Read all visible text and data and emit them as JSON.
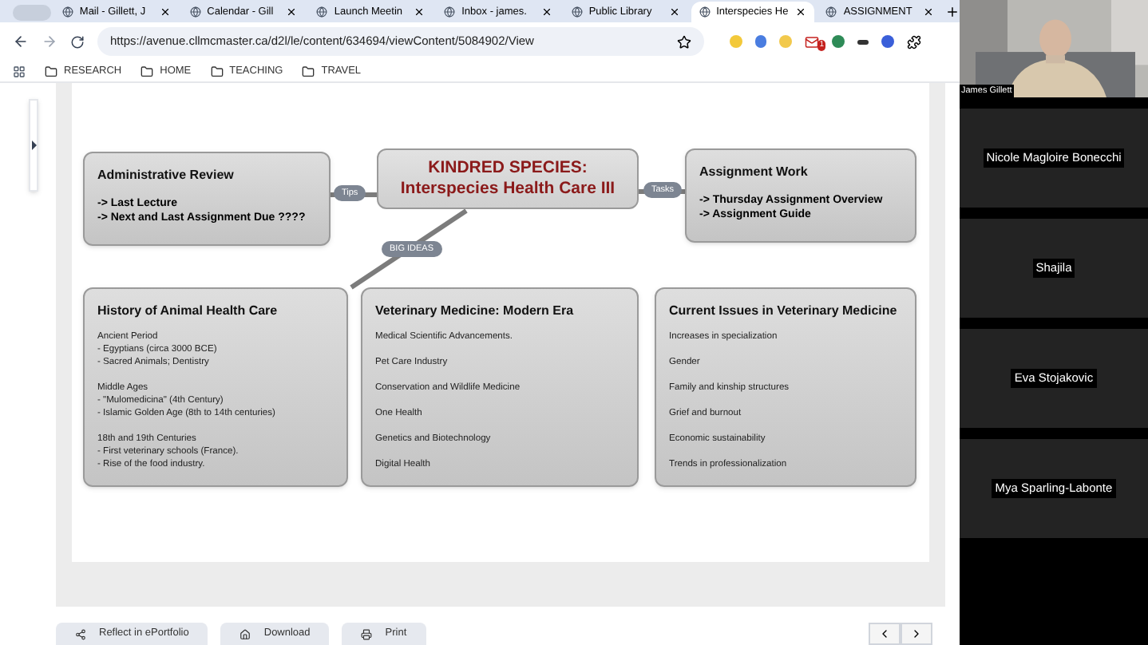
{
  "tabs": [
    {
      "label": "Mail - Gillett, J",
      "selected": false
    },
    {
      "label": "Calendar - Gill",
      "selected": false
    },
    {
      "label": "Launch Meetin",
      "selected": false
    },
    {
      "label": "Inbox - james.",
      "selected": false
    },
    {
      "label": "Public Library",
      "selected": false
    },
    {
      "label": "Interspecies He",
      "selected": true
    },
    {
      "label": "ASSIGNMENT",
      "selected": false
    }
  ],
  "url": "https://avenue.cllmcmaster.ca/d2l/le/content/634694/viewContent/5084902/View",
  "extension_badge": "1",
  "bookmarks": [
    "RESEARCH",
    "HOME",
    "TEACHING",
    "TRAVEL"
  ],
  "mindmap": {
    "center": [
      "KINDRED SPECIES:",
      "Interspecies Health Care III"
    ],
    "connectors": [
      "Tips",
      "Tasks",
      "BIG IDEAS"
    ],
    "top_nodes": [
      {
        "title": "Administrative Review",
        "lines": [
          "-> Last Lecture",
          "-> Next and Last Assignment Due ????"
        ]
      },
      {
        "title": "Assignment Work",
        "lines": [
          "-> Thursday Assignment Overview",
          "-> Assignment Guide"
        ]
      }
    ],
    "bottom_nodes": [
      {
        "title": "History of Animal Health Care",
        "groups": [
          [
            "Ancient Period",
            "- Egyptians (circa 3000 BCE)",
            "- Sacred Animals; Dentistry"
          ],
          [
            "Middle Ages",
            "- \"Mulomedicina\" (4th Century)",
            "- Islamic Golden Age (8th to 14th centuries)"
          ],
          [
            "18th and 19th Centuries",
            "- First veterinary schools (France).",
            "- Rise of the food industry."
          ]
        ]
      },
      {
        "title": "Veterinary Medicine: Modern Era",
        "groups": [
          [
            "Medical Scientific Advancements."
          ],
          [
            "Pet Care Industry"
          ],
          [
            "Conservation and Wildlife Medicine"
          ],
          [
            "One Health"
          ],
          [
            "Genetics and Biotechnology"
          ],
          [
            "Digital Health"
          ]
        ]
      },
      {
        "title": "Current Issues in Veterinary Medicine",
        "groups": [
          [
            "Increases in specialization"
          ],
          [
            "Gender"
          ],
          [
            "Family and kinship structures"
          ],
          [
            "Grief and burnout"
          ],
          [
            "Economic sustainability"
          ],
          [
            "Trends in professionalization"
          ]
        ]
      }
    ]
  },
  "actions": [
    "Reflect in ePortfolio",
    "Download",
    "Print"
  ],
  "participants": [
    {
      "name": "James Gillett",
      "kind": "video"
    },
    {
      "name": "Nicole Magloire Bonecchi",
      "kind": "name"
    },
    {
      "name": "Shajila",
      "kind": "name"
    },
    {
      "name": "Eva Stojakovic",
      "kind": "name"
    },
    {
      "name": "Mya Sparling-Labonte",
      "kind": "name"
    }
  ]
}
